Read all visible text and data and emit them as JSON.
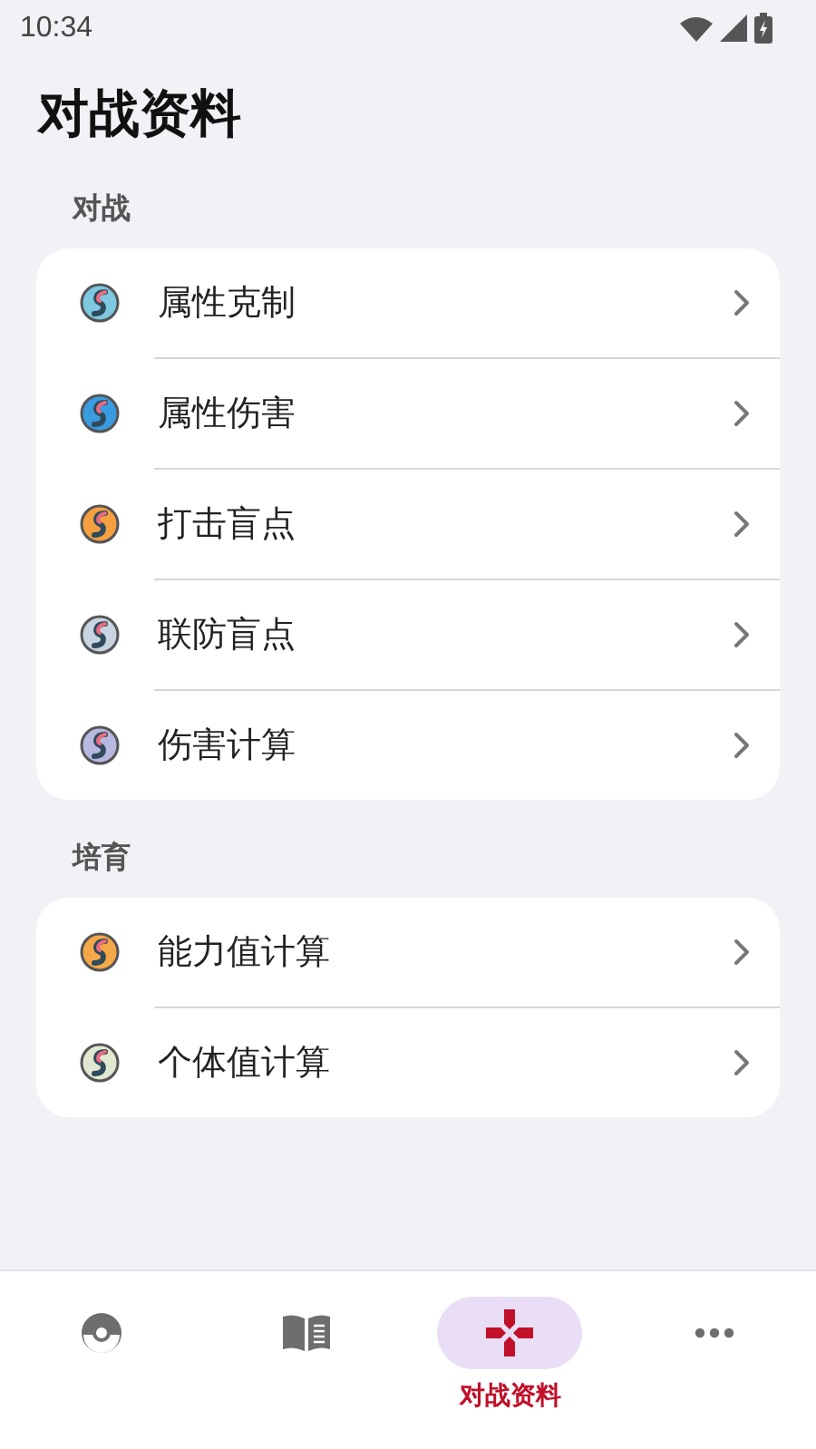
{
  "status_bar": {
    "time": "10:34"
  },
  "title": "对战资料",
  "sections": [
    {
      "heading": "对战",
      "items": [
        {
          "label": "属性克制",
          "color": "#7ec8e0"
        },
        {
          "label": "属性伤害",
          "color": "#3a9be0"
        },
        {
          "label": "打击盲点",
          "color": "#f5a040"
        },
        {
          "label": "联防盲点",
          "color": "#c8d4e0"
        },
        {
          "label": "伤害计算",
          "color": "#b8b8e0"
        }
      ]
    },
    {
      "heading": "培育",
      "items": [
        {
          "label": "能力值计算",
          "color": "#f5a848"
        },
        {
          "label": "个体值计算",
          "color": "#e0e8d0"
        }
      ]
    }
  ],
  "nav": [
    {
      "kind": "ball",
      "selected": false
    },
    {
      "kind": "book",
      "selected": false
    },
    {
      "kind": "dpad",
      "selected": true,
      "label": "对战资料"
    },
    {
      "kind": "more",
      "selected": false
    }
  ]
}
